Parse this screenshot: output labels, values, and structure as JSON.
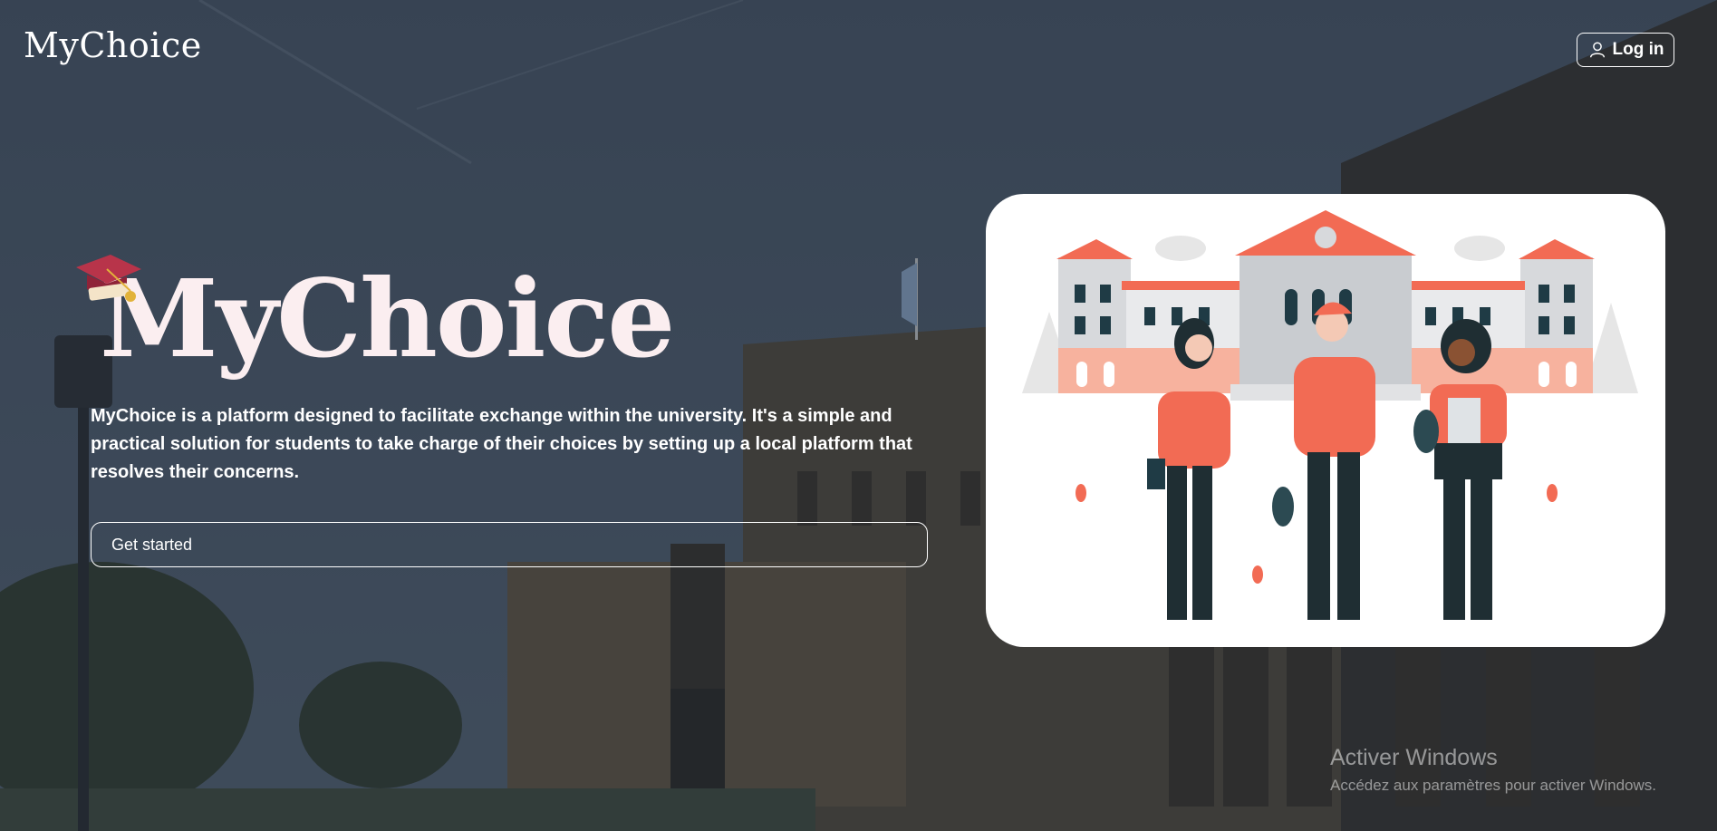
{
  "header": {
    "brand": "MyChoice",
    "login_label": "Log in",
    "login_icon": "user-icon"
  },
  "hero": {
    "title": "MyChoice",
    "title_icon": "graduation-cap-icon",
    "description": "MyChoice is a platform designed to facilitate exchange within the university. It's a simple and practical solution for students to take charge of their choices by setting up a local platform that resolves their concerns.",
    "cta_label": "Get started"
  },
  "illustration": {
    "subject": "students-in-front-of-university-illustration"
  },
  "background": {
    "subject": "university-building-photo"
  },
  "os_watermark": {
    "title": "Activer Windows",
    "subtitle": "Accédez aux paramètres pour activer Windows."
  },
  "colors": {
    "accent": "#f26b54",
    "dark": "#1f2e33",
    "overlay": "#2f3a46",
    "title": "#fbeef0"
  }
}
